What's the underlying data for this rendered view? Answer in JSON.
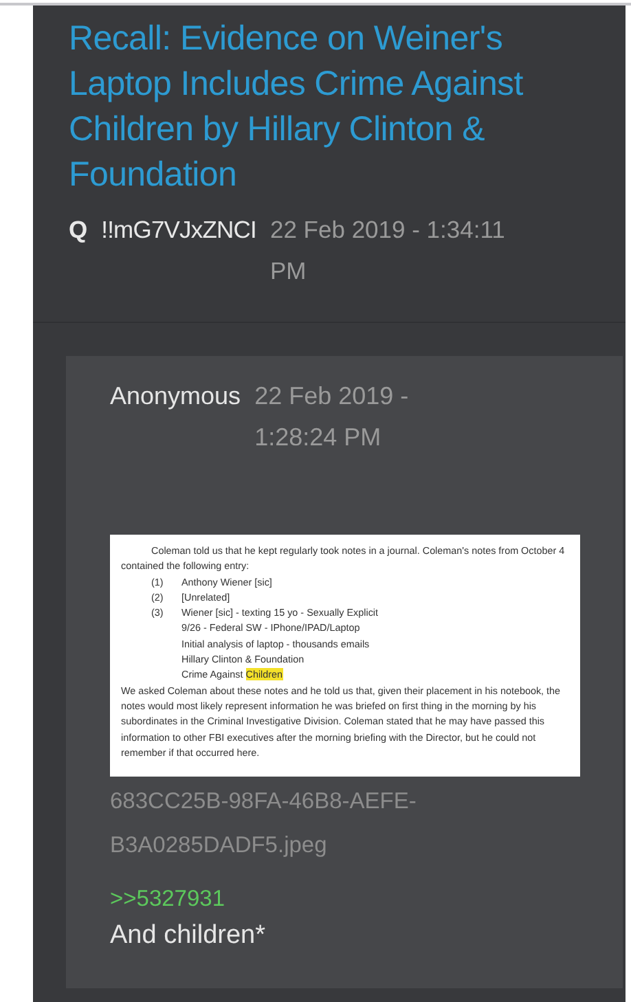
{
  "post": {
    "title": "Recall: Evidence on Weiner's Laptop Includes Crime Against Children by Hillary Clinton & Foundation",
    "author": "Q",
    "tripcode": "!!mG7VJxZNCI",
    "date": "22 Feb 2019 - 1:34:11 PM"
  },
  "reply": {
    "name": "Anonymous",
    "date": "22 Feb 2019 - 1:28:24 PM",
    "document": {
      "intro": "Coleman told us that he kept regularly took notes in a journal.  Coleman's notes from October 4 contained the following entry:",
      "entries": [
        {
          "number": "(1)",
          "text": "Anthony Wiener [sic]"
        },
        {
          "number": "(2)",
          "text": "[Unrelated]"
        },
        {
          "number": "(3)",
          "text": "Wiener [sic] - texting 15 yo - Sexually Explicit"
        },
        {
          "text": "9/26 - Federal SW - IPhone/IPAD/Laptop"
        },
        {
          "text": "Initial analysis of laptop - thousands emails"
        },
        {
          "text": "Hillary Clinton & Foundation"
        },
        {
          "text": "Crime Against",
          "highlighted": "Children"
        }
      ],
      "closing": "We asked Coleman about these notes and he told us that, given their placement in his notebook, the notes would most likely represent information he was briefed on first thing in the morning by his subordinates in the Criminal Investigative Division. Coleman stated that he may have passed this information to other FBI executives after the morning briefing with the Director, but he could not remember if that occurred here."
    },
    "filename": "683CC25B-98FA-46B8-AEFE-B3A0285DADF5.jpeg",
    "quote_link": ">>5327931",
    "message": "And children*"
  }
}
